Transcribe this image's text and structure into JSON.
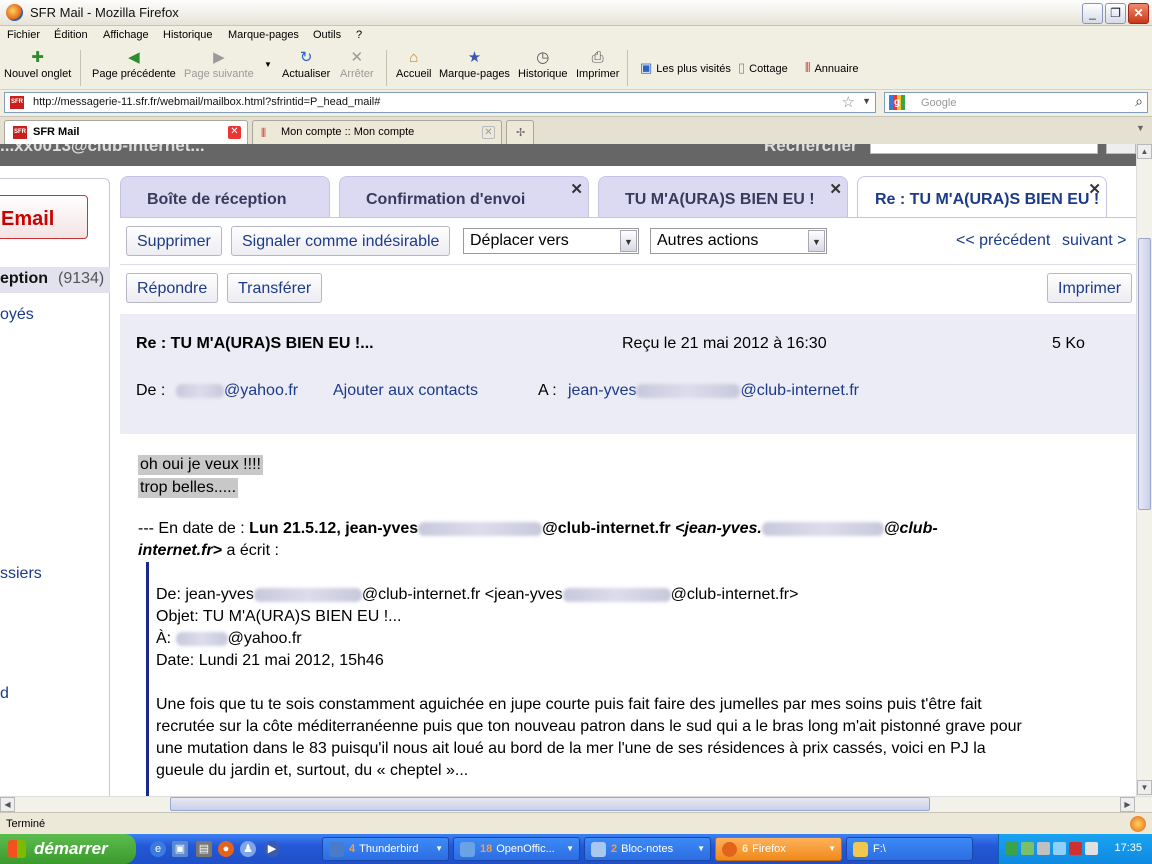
{
  "window": {
    "title": "SFR Mail - Mozilla Firefox",
    "min": "_",
    "max": "❐",
    "close": "✕"
  },
  "menu": [
    "Fichier",
    "Édition",
    "Affichage",
    "Historique",
    "Marque-pages",
    "Outils",
    "?"
  ],
  "toolbar": {
    "new_tab": "Nouvel onglet",
    "back": "Page précédente",
    "forward": "Page suivante",
    "reload": "Actualiser",
    "stop": "Arrêter",
    "home": "Accueil",
    "bookmarks": "Marque-pages",
    "history": "Historique",
    "print": "Imprimer",
    "bm1": "Les plus visités",
    "bm2": "Cottage",
    "bm3": "Annuaire"
  },
  "url": "http://messagerie-11.sfr.fr/webmail/mailbox.html?sfrintid=P_head_mail#",
  "search_placeholder": "Google",
  "browser_tabs": [
    "SFR Mail",
    "Mon compte :: Mon compte"
  ],
  "page": {
    "top_left": "...xx0013@club-internet...",
    "top_right": "Rechercher",
    "email_button": "Email",
    "reception_label": "eption",
    "reception_count": "(9134)",
    "left_links": [
      "oyés",
      "ssiers",
      "d"
    ],
    "mail_tabs": [
      "Boîte de réception",
      "Confirmation d'envoi",
      "TU M'A(URA)S BIEN EU !",
      "Re : TU M'A(URA)S BIEN EU !"
    ],
    "actions": {
      "delete": "Supprimer",
      "spam": "Signaler comme indésirable",
      "move": "Déplacer vers",
      "other": "Autres actions",
      "prev": "<< précédent",
      "next": "suivant >",
      "reply": "Répondre",
      "forward": "Transférer",
      "print": "Imprimer"
    },
    "header": {
      "subject": "Re : TU M'A(URA)S BIEN EU !...",
      "received": "Reçu le 21 mai 2012 à 16:30",
      "size": "5 Ko",
      "from_label": "De :",
      "from_domain": "@yahoo.fr",
      "add_contact": "Ajouter aux contacts",
      "to_label": "A :",
      "to_prefix": "jean-yves",
      "to_domain": "@club-internet.fr"
    },
    "body": {
      "line1": "oh oui je veux !!!!",
      "line2": "trop belles.....",
      "quote_intro_a": "--- En date de :",
      "quote_intro_b": "Lun 21.5.12, jean-yves",
      "quote_intro_c": "@club-internet.fr",
      "quote_intro_d": "<jean-yves.",
      "quote_intro_e": "@club-",
      "quote_intro_f": "internet.fr>",
      "quote_intro_g": "a écrit :",
      "q_from_a": "De: jean-yves",
      "q_from_b": "@club-internet.fr <jean-yves",
      "q_from_c": "@club-internet.fr>",
      "q_subject": "Objet: TU M'A(URA)S BIEN EU !...",
      "q_to_a": "À:",
      "q_to_b": "@yahoo.fr",
      "q_date": "Date: Lundi 21 mai 2012, 15h46",
      "p1": "Une fois que tu te sois constamment aguichée en jupe courte puis fait faire des jumelles par mes soins puis t'être fait",
      "p2": "recrutée sur la côte méditerranéenne puis que ton nouveau patron dans le sud qui a le bras long m'ait pistonné grave pour",
      "p3": "une mutation dans le 83 puisqu'il nous ait loué au bord de la mer l'une de ses résidences à prix cassés, voici en PJ la",
      "p4": "gueule du jardin et, surtout, du « cheptel »..."
    }
  },
  "status": "Terminé",
  "taskbar": {
    "start": "démarrer",
    "tasks": [
      {
        "count": "4",
        "label": "Thunderbird"
      },
      {
        "count": "18",
        "label": "OpenOffic..."
      },
      {
        "count": "2",
        "label": "Bloc-notes"
      },
      {
        "count": "6",
        "label": "Firefox"
      },
      {
        "count": "",
        "label": "F:\\"
      }
    ],
    "time": "17:35"
  },
  "colors": {
    "accent": "#1b3a8a",
    "tab_bg": "#dcdaf3",
    "header_bg": "#ececf6"
  }
}
